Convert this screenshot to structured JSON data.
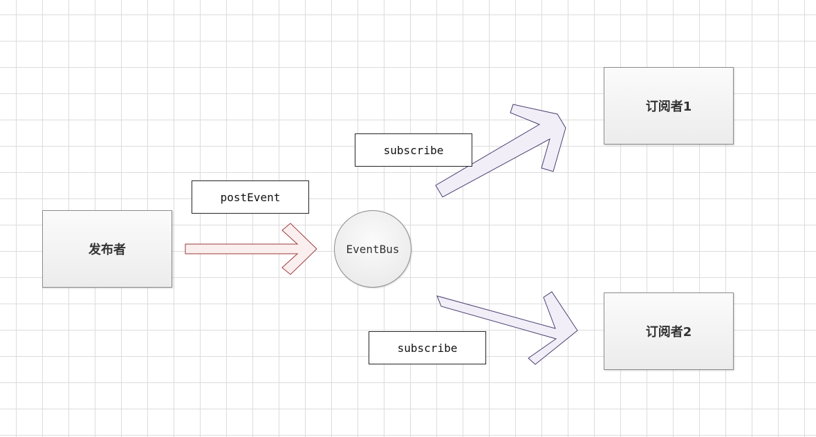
{
  "nodes": {
    "publisher": "发布者",
    "event_bus": "EventBus",
    "subscriber_1": "订阅者1",
    "subscriber_2": "订阅者2"
  },
  "edge_labels": {
    "post_event": "postEvent",
    "subscribe_top": "subscribe",
    "subscribe_bottom": "subscribe"
  },
  "colors": {
    "post_arrow_stroke": "#9a3b3b",
    "post_arrow_fill": "#fbeeee",
    "subscribe_arrow_stroke": "#4a3d6e",
    "subscribe_arrow_fill": "#f1eef8",
    "grid_line": "#dcdcdc"
  }
}
